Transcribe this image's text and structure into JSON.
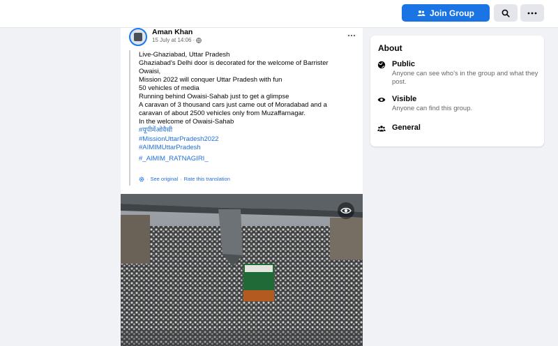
{
  "topbar": {
    "join_label": "Join Group",
    "icons": {
      "join": "group-icon",
      "search": "search-icon",
      "more": "more-horizontal-icon"
    }
  },
  "post": {
    "author": "Aman Khan",
    "timestamp": "15 July at 14:06",
    "privacy_icon": "globe-icon",
    "more_icon": "more-horizontal-icon",
    "translation_lines": [
      "Live-Ghaziabad, Uttar Pradesh",
      "Ghaziabad's Delhi door is decorated for the welcome of Barrister",
      "Owaisi,",
      "Mission 2022 will conquer Uttar Pradesh with fun",
      "50 vehicles of media",
      "Running behind Owaisi-Sahab just to get a glimpse",
      "A caravan of 3 thousand cars just came out of Moradabad and a",
      "caravan of about 2500 vehicles only from Muzaffarnagar.",
      "In the welcome of Owaisi-Sahab"
    ],
    "hashtags": [
      "#यूपीमेंओवैसी",
      "#MissionUttarPradesh2022",
      "#AIMIMUttarPradesh",
      "#_AIMIM_RATNAGIRI_"
    ],
    "see_original": "See original",
    "rate_translation": "Rate this translation",
    "photo_icon": "eye-icon"
  },
  "about": {
    "title": "About",
    "items": [
      {
        "icon": "globe-icon",
        "title": "Public",
        "description": "Anyone can see who's in the group and what they post."
      },
      {
        "icon": "eye-icon",
        "title": "Visible",
        "description": "Anyone can find this group."
      },
      {
        "icon": "group-icon",
        "title": "General",
        "description": ""
      }
    ]
  },
  "colors": {
    "accent": "#1b74e4",
    "link": "#216fdb",
    "background": "#f0f2f5",
    "secondary_text": "#65676b"
  }
}
